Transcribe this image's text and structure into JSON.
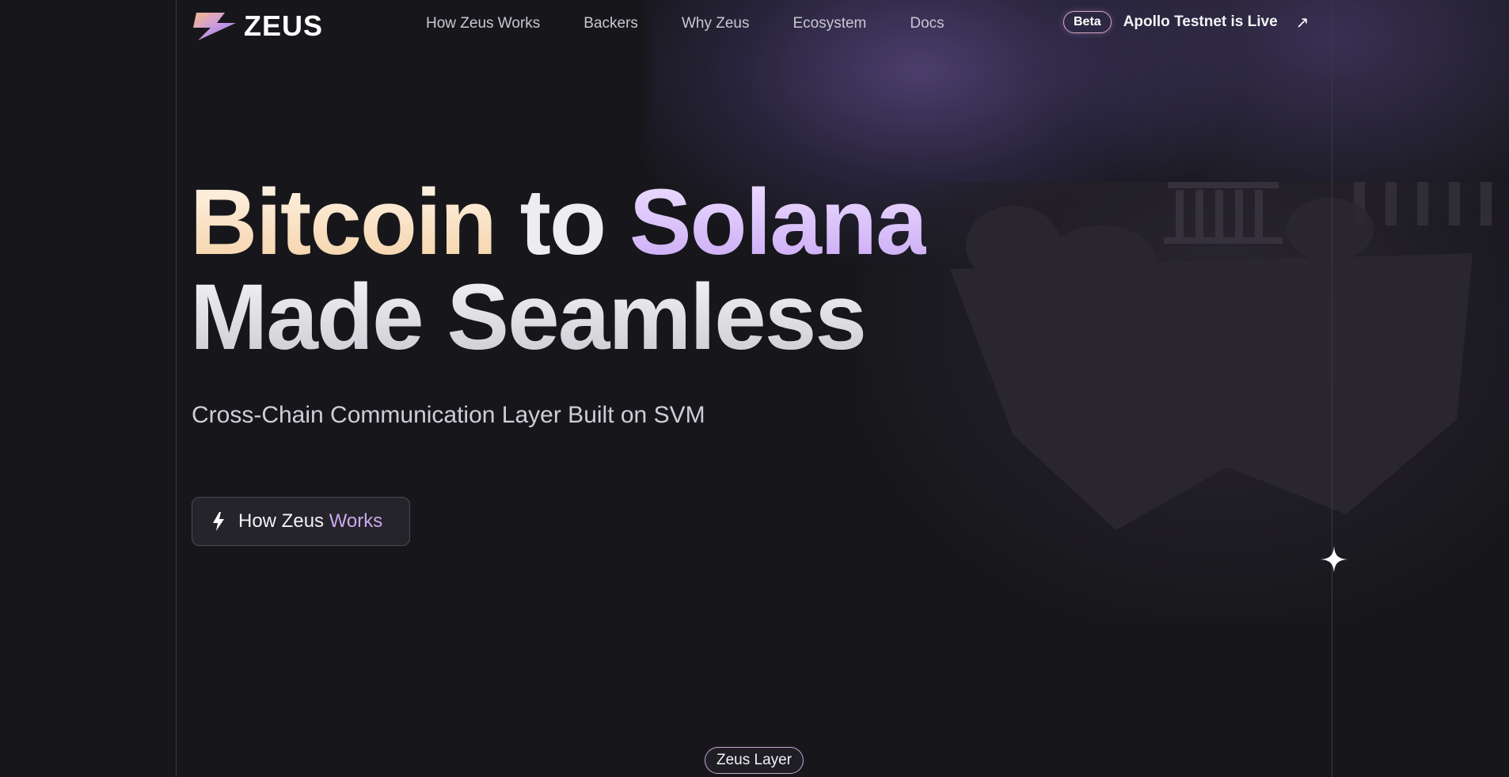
{
  "logo": {
    "text": "ZEUS",
    "icon": "lightning-bolt-icon"
  },
  "nav": {
    "items": [
      {
        "label": "How Zeus Works"
      },
      {
        "label": "Backers"
      },
      {
        "label": "Why Zeus"
      },
      {
        "label": "Ecosystem"
      },
      {
        "label": "Docs"
      }
    ]
  },
  "announcement": {
    "badge": "Beta",
    "text": "Apollo Testnet is Live",
    "icon": "arrow-up-right-icon"
  },
  "hero": {
    "title_word1": "Bitcoin",
    "title_word2": "to",
    "title_word3": "Solana",
    "title_line2": "Made Seamless",
    "subtitle": "Cross-Chain Communication Layer Built on SVM",
    "cta_part1": "How Zeus ",
    "cta_part2": "Works",
    "cta_icon": "bolt-icon"
  },
  "footer_pill": {
    "label": "Zeus Layer"
  },
  "colors": {
    "background": "#17171b",
    "bitcoin_gradient": "#f4cfa3",
    "solana_gradient": "#c8a6f5",
    "accent_purple": "#8c6ed2"
  }
}
